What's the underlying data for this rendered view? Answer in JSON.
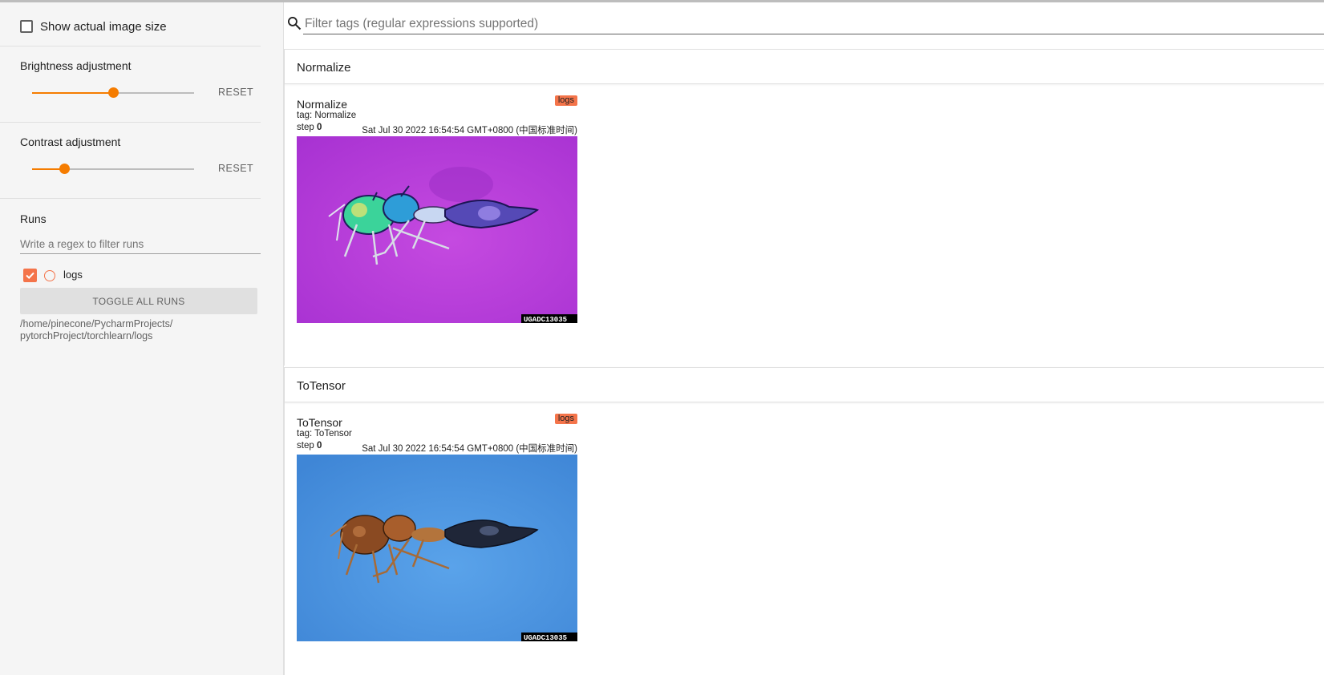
{
  "sidebar": {
    "show_actual_size_label": "Show actual image size",
    "brightness": {
      "title": "Brightness adjustment",
      "value_fraction": 0.5,
      "reset_label": "RESET"
    },
    "contrast": {
      "title": "Contrast adjustment",
      "value_fraction": 0.2,
      "reset_label": "RESET"
    },
    "runs": {
      "title": "Runs",
      "filter_placeholder": "Write a regex to filter runs",
      "items": [
        {
          "label": "logs",
          "checked": true,
          "color": "#f4744a"
        }
      ],
      "toggle_all_label": "TOGGLE ALL RUNS",
      "logdir_line1": "/home/pinecone/PycharmProjects/",
      "logdir_line2": "pytorchProject/torchlearn/logs"
    }
  },
  "search": {
    "placeholder": "Filter tags (regular expressions supported)"
  },
  "groups": [
    {
      "title": "Normalize",
      "card": {
        "title": "Normalize",
        "tag_line": "tag: Normalize",
        "step_label": "step",
        "step_value": "0",
        "timestamp": "Sat Jul 30 2022 16:54:54 GMT+0800 (中国标准时间)",
        "run_chip": "logs",
        "watermark": "UGADC13035",
        "image_bg": "#b63ddb"
      }
    },
    {
      "title": "ToTensor",
      "card": {
        "title": "ToTensor",
        "tag_line": "tag: ToTensor",
        "step_label": "step",
        "step_value": "0",
        "timestamp": "Sat Jul 30 2022 16:54:54 GMT+0800 (中国标准时间)",
        "run_chip": "logs",
        "watermark": "UGADC13035",
        "image_bg": "#4a94e0"
      }
    }
  ],
  "colors": {
    "accent": "#f57c00",
    "run": "#f4744a"
  }
}
